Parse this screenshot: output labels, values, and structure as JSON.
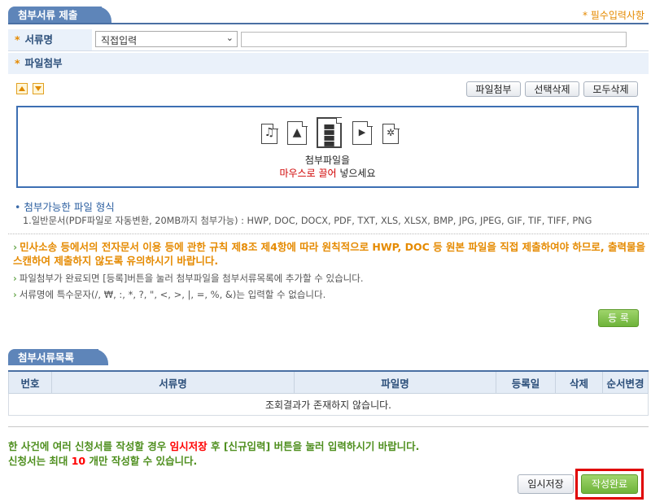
{
  "section1": {
    "title": "첨부서류 제출",
    "required_note": "* 필수입력사항"
  },
  "doc_name": {
    "label": "서류명",
    "select_value": "직접입력",
    "input_value": ""
  },
  "attach": {
    "label": "파일첨부",
    "buttons": {
      "attach": "파일첨부",
      "delete_selected": "선택삭제",
      "delete_all": "모두삭제"
    },
    "drop_line1": "첨부파일을",
    "drop_line2_red": "마우스로 끌어",
    "drop_line2_rest": " 넣으세요",
    "icons": [
      "music-file-icon",
      "image-file-icon",
      "document-file-icon",
      "video-file-icon",
      "settings-file-icon"
    ]
  },
  "formats": {
    "title": "첨부가능한 파일 형식",
    "desc": "1.일반문서(PDF파일로 자동변환, 20MB까지 첨부가능) : HWP, DOC, DOCX, PDF, TXT, XLS, XLSX, BMP, JPG, JPEG, GIF, TIF, TIFF, PNG"
  },
  "notices": {
    "warning": "민사소송 등에서의 전자문서 이용 등에 관한 규칙 제8조 제4항에 따라 원칙적으로 HWP, DOC 등 원본 파일을 직접 제출하여야 하므로, 출력물을 스캔하여 제출하지 않도록 유의하시기 바랍니다.",
    "info1": "파일첨부가 완료되면 [등록]버튼을 눌러 첨부파일을 첨부서류목록에 추가할 수 있습니다.",
    "info2": "서류명에 특수문자(/, ₩, :, *, ?, \", <, >, |, =, %, &)는 입력할 수 없습니다."
  },
  "register_button": "등 록",
  "section2": {
    "title": "첨부서류목록"
  },
  "table": {
    "headers": [
      "번호",
      "서류명",
      "파일명",
      "등록일",
      "삭제",
      "순서변경"
    ],
    "empty_message": "조회결과가 존재하지 않습니다."
  },
  "bottom": {
    "line1_a": "한 사건에 여러 신청서를 작성할 경우 ",
    "line1_red": "임시저장",
    "line1_b": " 후 [신규입력] 버튼을 눌러 입력하시기 바랍니다.",
    "line2_a": "신청서는 최대 ",
    "line2_red": "10",
    "line2_b": " 개만 작성할 수 있습니다."
  },
  "buttons": {
    "temp_save": "임시저장",
    "complete": "작성완료"
  },
  "colors": {
    "header_blue": "#5e85b9",
    "label_bg": "#eaf1fa",
    "warning_orange": "#e58a00",
    "green_text": "#4f8f1f",
    "red_highlight": "#ff0000"
  }
}
